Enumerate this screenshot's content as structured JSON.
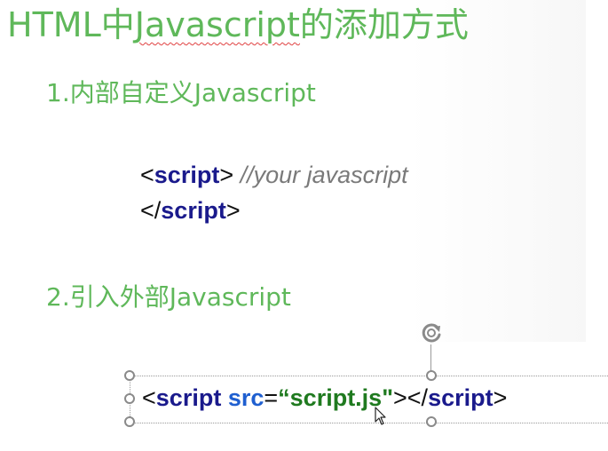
{
  "slide": {
    "title_prefix": "HTML中",
    "title_underlined": "Javascript",
    "title_suffix": "的添加方式",
    "heading1": "1.内部自定义Javascript",
    "heading2": "2.引入外部Javascript",
    "code_inline": {
      "open_lt": "<",
      "open_tag": "script",
      "open_gt": ">",
      "comment": " //your javascript",
      "close_lt": "</",
      "close_tag": "script",
      "close_gt": ">"
    },
    "code_external": {
      "lt": "<",
      "tag": "script",
      "space": " ",
      "attr": "src",
      "eq": "=",
      "value": "“script.js\"",
      "gt_close": "></",
      "close_tag": "script",
      "gt": ">"
    }
  },
  "colors": {
    "heading_green": "#5fb85a",
    "keyword_navy": "#1a1a8c",
    "attr_blue": "#1f5fd0",
    "string_green": "#1f7a1f",
    "comment_gray": "#7a7a7a"
  },
  "icons": {
    "rotate": "rotate-handle-icon",
    "cursor": "mouse-cursor-icon"
  }
}
